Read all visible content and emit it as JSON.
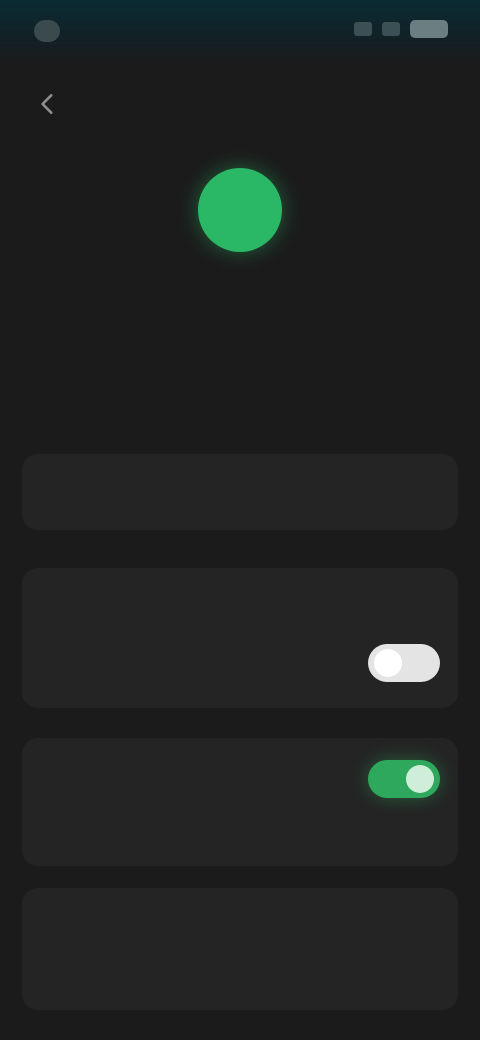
{
  "status_bar": {
    "time": ""
  },
  "profile": {
    "name": "",
    "email": "",
    "avatar_color": "#2ab866"
  },
  "stats": [
    {
      "label": "",
      "value": ""
    },
    {
      "label": "",
      "value": ""
    },
    {
      "label": "",
      "value": ""
    }
  ],
  "cards": {
    "card1": {
      "label": ""
    },
    "card2": {
      "heading": "",
      "row_label": "",
      "toggle_on": false
    },
    "card3": {
      "row_label": "",
      "sub": "",
      "toggle_on": true
    },
    "card4": {
      "heading": "",
      "row_label": ""
    }
  },
  "icons": {
    "back": "arrow-left-icon"
  },
  "colors": {
    "accent_green": "#2ea85c",
    "link_blue": "#4aa6c4",
    "background": "#1b1b1b"
  }
}
